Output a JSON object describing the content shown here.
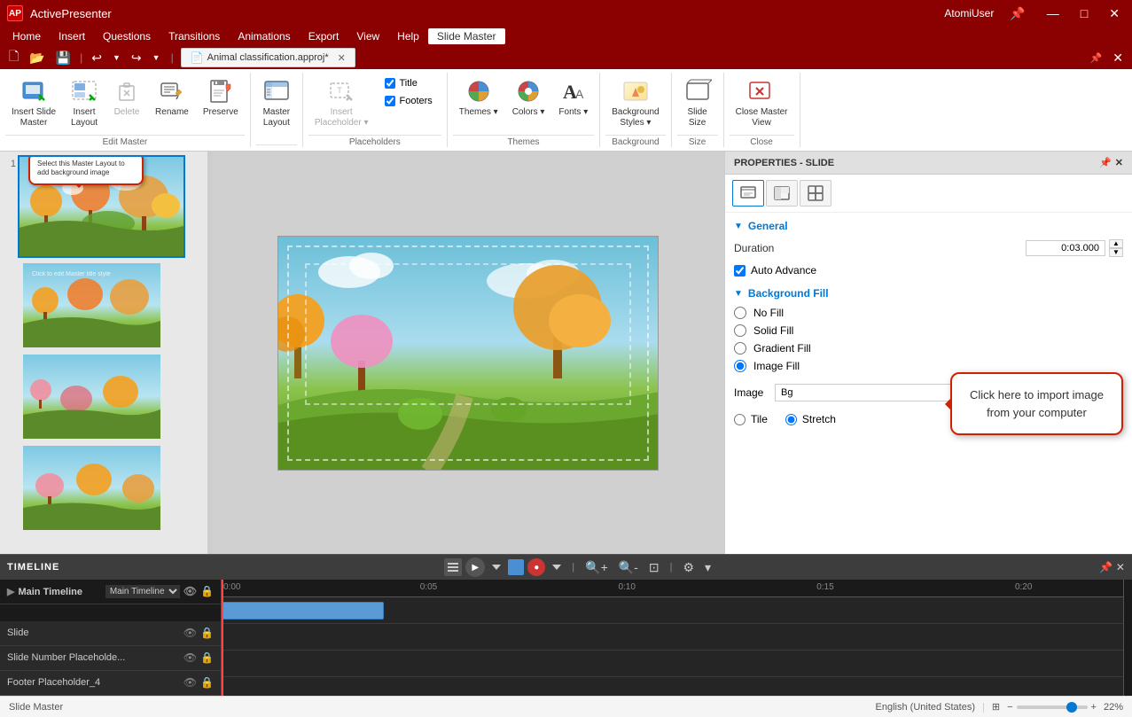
{
  "titlebar": {
    "app": "ActivePresenter",
    "logo": "AP",
    "user": "AtomiUser",
    "btns": [
      "▾",
      "—",
      "□",
      "✕"
    ]
  },
  "menubar": {
    "items": [
      "Home",
      "Insert",
      "Questions",
      "Transitions",
      "Animations",
      "Export",
      "View",
      "Help",
      "Slide Master"
    ]
  },
  "ribbon": {
    "active_tab": "Slide Master",
    "groups": [
      {
        "label": "Edit Master",
        "items": [
          {
            "id": "insert-slide-master",
            "icon": "⊞",
            "label": "Insert Slide\nMaster",
            "disabled": false
          },
          {
            "id": "insert-layout",
            "icon": "⊟",
            "label": "Insert\nLayout",
            "disabled": false
          },
          {
            "id": "delete",
            "icon": "✕",
            "label": "Delete",
            "disabled": true
          },
          {
            "id": "rename",
            "icon": "✎",
            "label": "Rename",
            "disabled": false
          },
          {
            "id": "preserve",
            "icon": "📌",
            "label": "Preserve",
            "disabled": false
          }
        ]
      },
      {
        "label": "",
        "items": [
          {
            "id": "master-layout",
            "icon": "▤",
            "label": "Master\nLayout",
            "disabled": false
          }
        ]
      },
      {
        "label": "Placeholders",
        "checkboxes": [
          "Title",
          "Footers"
        ],
        "insert_btn": {
          "id": "insert-placeholder",
          "icon": "▣",
          "label": "Insert\nPlaceholder",
          "disabled": false
        }
      },
      {
        "label": "Themes",
        "items": [
          {
            "id": "themes",
            "icon": "🎨",
            "label": "Themes",
            "disabled": false
          },
          {
            "id": "colors",
            "icon": "🎨",
            "label": "Colors",
            "disabled": false
          },
          {
            "id": "fonts",
            "icon": "A",
            "label": "Fonts",
            "disabled": false
          }
        ]
      },
      {
        "label": "Background",
        "items": [
          {
            "id": "background-styles",
            "icon": "🖌",
            "label": "Background\nStyles",
            "disabled": false
          }
        ]
      },
      {
        "label": "Size",
        "items": [
          {
            "id": "slide-size",
            "icon": "⊡",
            "label": "Slide\nSize",
            "disabled": false
          }
        ]
      },
      {
        "label": "Close",
        "items": [
          {
            "id": "close-master-view",
            "icon": "✕",
            "label": "Close Master\nView",
            "disabled": false
          }
        ]
      }
    ]
  },
  "quickaccess": {
    "doc_title": "Animal classification.approj*",
    "btns": [
      "🗋",
      "📂",
      "💾",
      "↩",
      "↪"
    ]
  },
  "properties": {
    "title": "PROPERTIES - SLIDE",
    "tabs": [
      "table-icon",
      "chart-icon",
      "image-icon"
    ],
    "general": {
      "label": "General",
      "duration_label": "Duration",
      "duration_value": "0:03.000",
      "auto_advance_label": "Auto Advance",
      "auto_advance_checked": true
    },
    "background_fill": {
      "label": "Background Fill",
      "options": [
        "No Fill",
        "Solid Fill",
        "Gradient Fill",
        "Image Fill"
      ],
      "selected": "Image Fill",
      "image_label": "Image",
      "image_value": "Bg",
      "tile_label": "Tile",
      "stretch_label": "Stretch",
      "stretch_selected": true
    }
  },
  "callout1": {
    "text": "Select this Master Layout to add background image"
  },
  "callout2": {
    "text": "Click here to import image from your computer"
  },
  "timeline": {
    "title": "TIMELINE",
    "main_timeline_label": "Main Timeline",
    "rows": [
      {
        "label": "Slide",
        "has_block": true,
        "block_color": "blue"
      },
      {
        "label": "Slide Number Placeholde...",
        "has_block": false
      },
      {
        "label": "Footer Placeholder_4",
        "has_block": false
      }
    ],
    "time_marks": [
      "0:00",
      "0:05",
      "0:10",
      "0:15",
      "0:20"
    ]
  },
  "statusbar": {
    "mode": "Slide Master",
    "language": "English (United States)",
    "zoom": "22%"
  }
}
